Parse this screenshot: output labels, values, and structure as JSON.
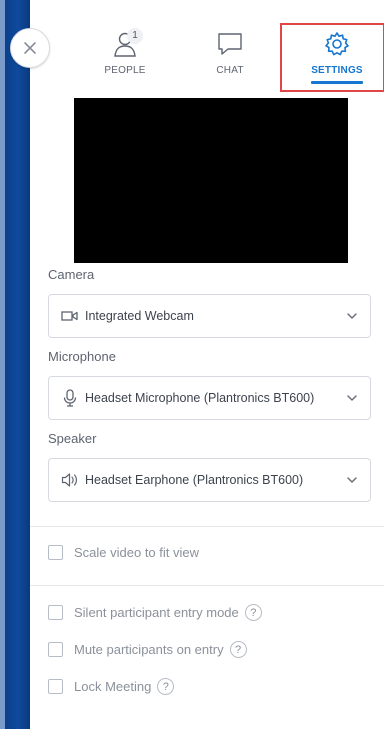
{
  "tabs": {
    "people": {
      "label": "PEOPLE",
      "badge": "1",
      "icon": "people-icon"
    },
    "chat": {
      "label": "CHAT",
      "icon": "chat-icon"
    },
    "settings": {
      "label": "SETTINGS",
      "icon": "gear-icon",
      "active": true
    }
  },
  "colors": {
    "accent": "#1676d0",
    "highlight": "#e24545",
    "left_strip": "#0f4a9e"
  },
  "camera": {
    "label": "Camera",
    "value": "Integrated Webcam",
    "icon": "webcam-icon"
  },
  "microphone": {
    "label": "Microphone",
    "value": "Headset Microphone (Plantronics BT600)",
    "icon": "microphone-icon"
  },
  "speaker": {
    "label": "Speaker",
    "value": "Headset Earphone (Plantronics BT600)",
    "icon": "speaker-icon"
  },
  "options": {
    "scale_video": "Scale video to fit view",
    "silent_entry": "Silent participant entry mode",
    "mute_on_entry": "Mute participants on entry",
    "lock_meeting": "Lock Meeting"
  },
  "help_symbol": "?"
}
